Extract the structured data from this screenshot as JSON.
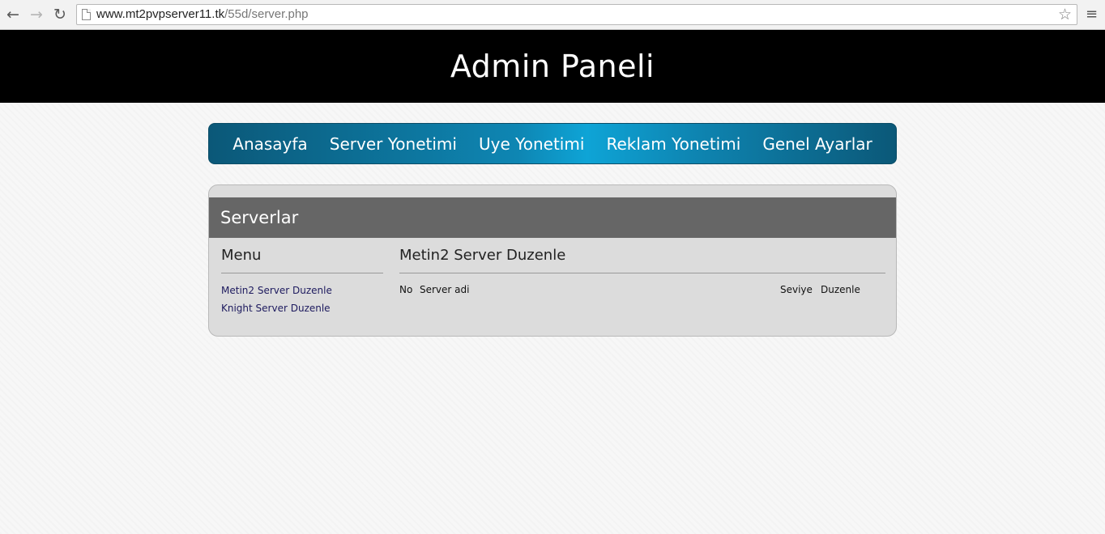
{
  "browser": {
    "url_host": "www.mt2pvpserver11.tk",
    "url_path": "/55d/server.php"
  },
  "header": {
    "title": "Admin Paneli"
  },
  "nav": {
    "items": [
      {
        "label": "Anasayfa"
      },
      {
        "label": "Server Yonetimi"
      },
      {
        "label": "Uye Yonetimi"
      },
      {
        "label": "Reklam Yonetimi"
      },
      {
        "label": "Genel Ayarlar"
      }
    ]
  },
  "panel": {
    "title": "Serverlar",
    "sidebar": {
      "title": "Menu",
      "links": [
        {
          "label": "Metin2 Server Duzenle"
        },
        {
          "label": "Knight Server Duzenle"
        }
      ]
    },
    "main": {
      "title": "Metin2 Server Duzenle",
      "columns": [
        "No",
        "Server adi",
        "Seviye",
        "Duzenle"
      ]
    }
  }
}
